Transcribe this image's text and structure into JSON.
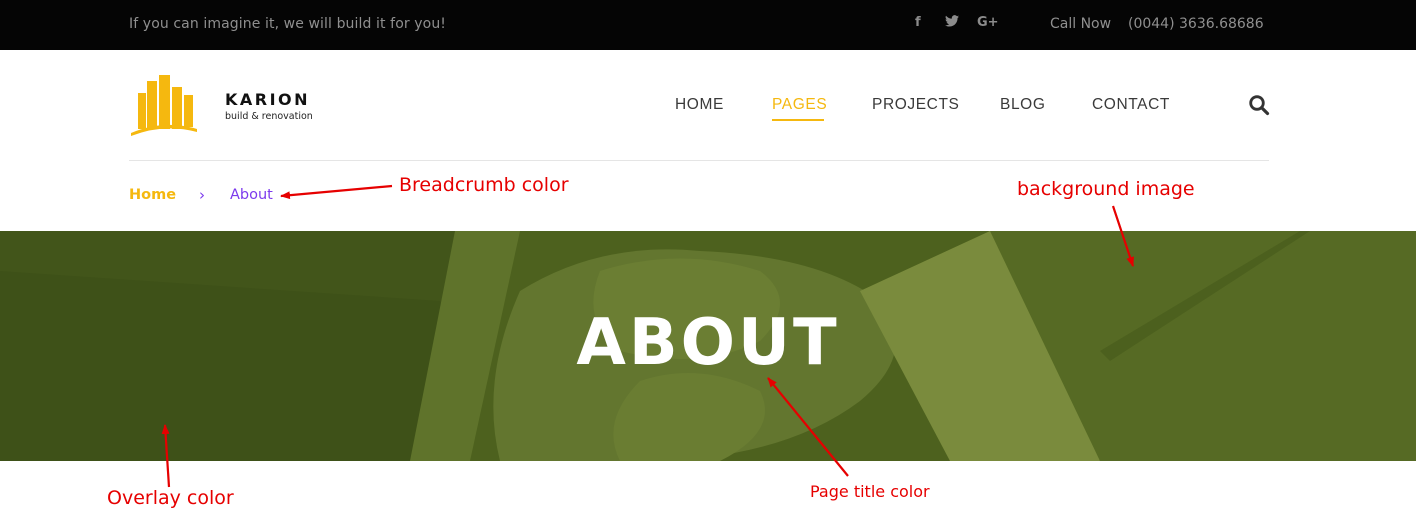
{
  "topbar": {
    "tagline": "If you can imagine it, we will build it for you!",
    "social": [
      {
        "name": "facebook-icon",
        "glyph": "f"
      },
      {
        "name": "twitter-icon",
        "glyph": "🐦"
      },
      {
        "name": "google-plus-icon",
        "glyph": "G+"
      }
    ],
    "call_label": "Call Now",
    "call_number": "(0044) 3636.68686"
  },
  "brand": {
    "name": "KARION",
    "tagline": "build & renovation",
    "accent": "#f5b80f"
  },
  "nav": {
    "items": [
      "HOME",
      "PAGES",
      "PROJECTS",
      "BLOG",
      "CONTACT"
    ],
    "active": "PAGES"
  },
  "breadcrumb": {
    "home": "Home",
    "separator": "›",
    "current": "About",
    "color": "#7c3aed"
  },
  "hero": {
    "title": "ABOUT",
    "overlay_color": "#4b5e1c"
  },
  "annotations": {
    "breadcrumb_color": "Breadcrumb color",
    "background_image": "background image",
    "overlay_color": "Overlay color",
    "page_title_color": "Page title color"
  }
}
